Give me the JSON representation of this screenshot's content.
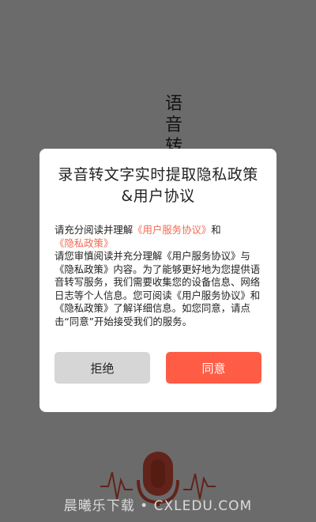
{
  "background": {
    "title_chars": [
      "语",
      "音",
      "转"
    ],
    "accent": "#e8553f"
  },
  "dialog": {
    "title": "录音转文字实时提取隐私政策&用户协议",
    "intro_prefix": "请充分阅读并理解",
    "link_user_agreement": "《用户服务协议》",
    "intro_and": "和",
    "link_privacy_policy": "《隐私政策》",
    "body": "请您审慎阅读并充分理解《用户服务协议》与《隐私政策》内容。为了能够更好地为您提供语音转写服务，我们需要收集您的设备信息、网络日志等个人信息。您可阅读《用户服务协议》和《隐私政策》了解详细信息。如您同意，请点击“同意”开始接受我们的服务。",
    "reject_label": "拒绝",
    "agree_label": "同意",
    "colors": {
      "link": "#f26a52",
      "agree_button": "#ff5c45",
      "reject_button": "#d6d6d6"
    }
  },
  "watermark": {
    "text": "晨曦乐下载 • CXLEDU.COM"
  }
}
